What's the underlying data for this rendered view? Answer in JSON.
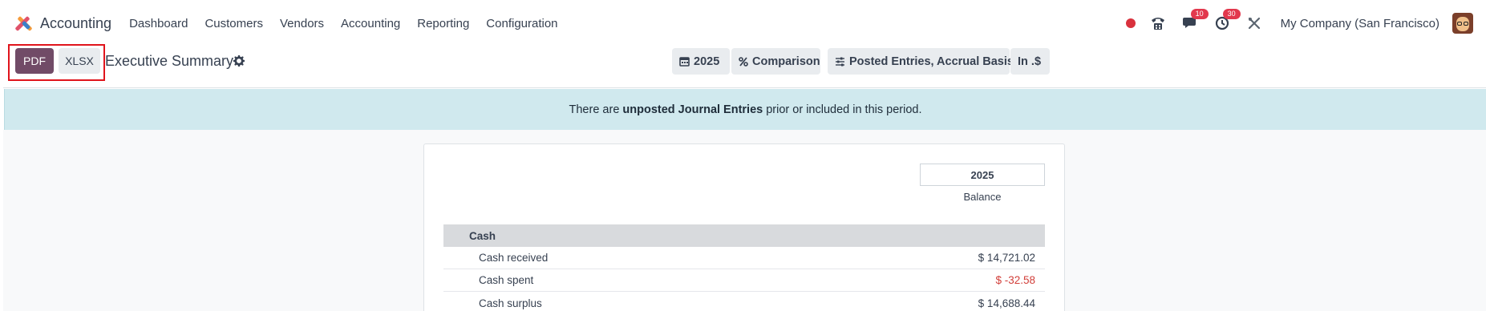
{
  "navbar": {
    "app_name": "Accounting",
    "menu": [
      "Dashboard",
      "Customers",
      "Vendors",
      "Accounting",
      "Reporting",
      "Configuration"
    ],
    "messages_count": "10",
    "activities_count": "30",
    "company": "My Company (San Francisco)"
  },
  "control": {
    "pdf_label": "PDF",
    "xlsx_label": "XLSX",
    "title": "Executive Summary",
    "filters": {
      "period": "2025",
      "comparison": "Comparison",
      "options": "Posted Entries, Accrual Basis",
      "currency": "In .$"
    }
  },
  "alert": {
    "prefix": "There are",
    "bold": "unposted Journal Entries",
    "suffix": "prior or included in this period."
  },
  "report": {
    "column_header": "2025",
    "column_sub": "Balance",
    "section": "Cash",
    "rows": [
      {
        "label": "Cash received",
        "value": "$ 14,721.02",
        "negative": false
      },
      {
        "label": "Cash spent",
        "value": "$ -32.58",
        "negative": true
      },
      {
        "label": "Cash surplus",
        "value": "$ 14,688.44",
        "negative": false
      }
    ]
  },
  "colors": {
    "primary": "#714b67",
    "alert_bg": "#d0e9ee",
    "negative": "#d23f3a",
    "badge": "#e2384d"
  }
}
